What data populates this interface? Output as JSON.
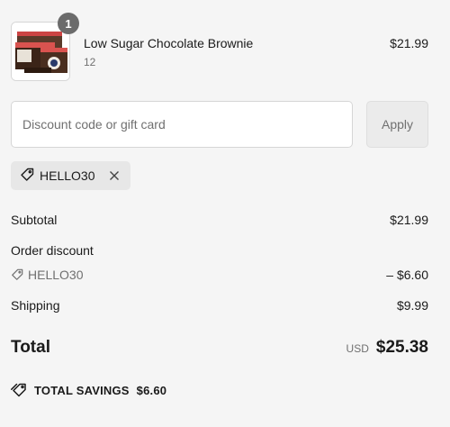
{
  "line_item": {
    "quantity": "1",
    "name": "Low Sugar Chocolate Brownie",
    "variant": "12",
    "price": "$21.99"
  },
  "discount": {
    "placeholder": "Discount code or gift card",
    "apply_label": "Apply",
    "applied_code": "HELLO30"
  },
  "summary": {
    "subtotal_label": "Subtotal",
    "subtotal_value": "$21.99",
    "order_discount_label": "Order discount",
    "discount_code": "HELLO30",
    "discount_value": "– $6.60",
    "shipping_label": "Shipping",
    "shipping_value": "$9.99",
    "total_label": "Total",
    "currency": "USD",
    "total_value": "$25.38",
    "savings_label": "TOTAL SAVINGS",
    "savings_value": "$6.60"
  },
  "icons": {
    "tag": "tag-icon",
    "close": "close-icon"
  }
}
